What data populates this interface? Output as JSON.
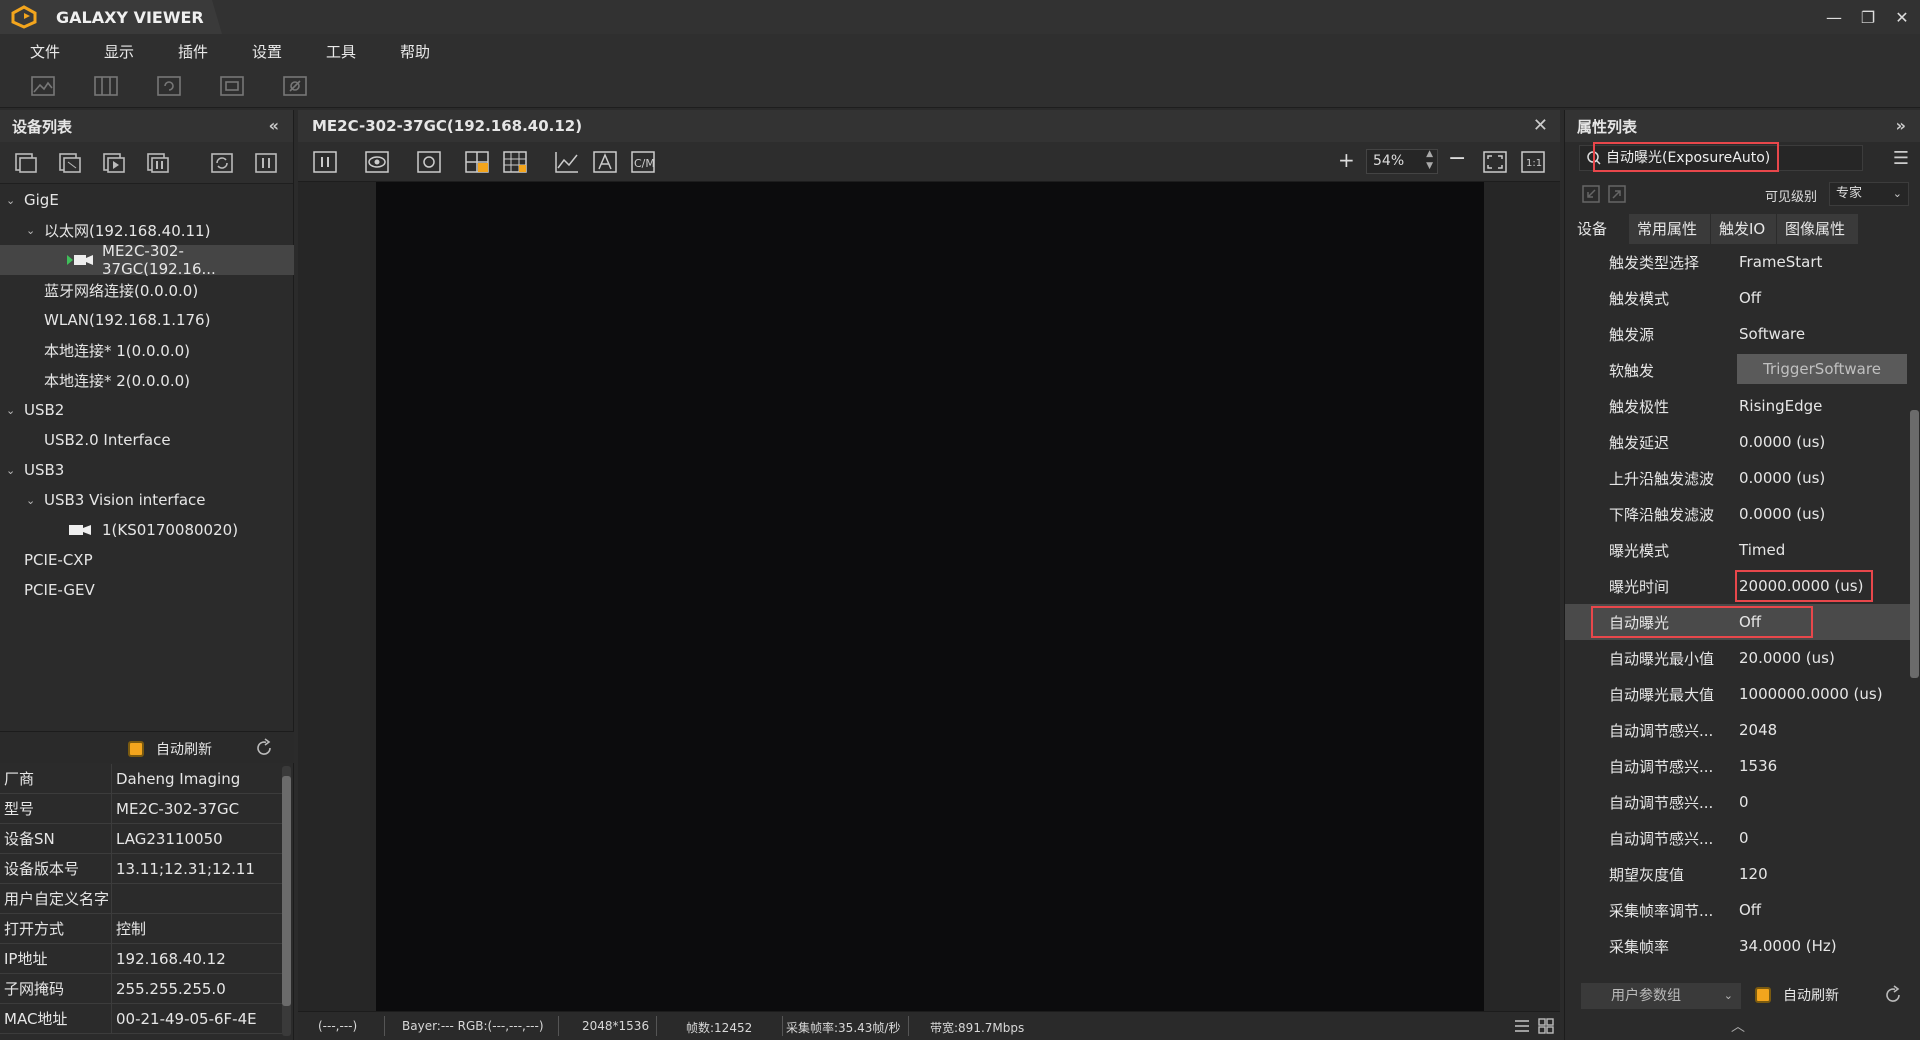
{
  "app": {
    "title": "GALAXY VIEWER"
  },
  "window_controls": {
    "minimize": "—",
    "restore": "❐",
    "close": "✕"
  },
  "menu": [
    "文件",
    "显示",
    "插件",
    "设置",
    "工具",
    "帮助"
  ],
  "left_panel": {
    "title": "设备列表",
    "collapse_glyph": "«",
    "tree": [
      {
        "label": "GigE",
        "level": 0,
        "expanded": true
      },
      {
        "label": "以太网(192.168.40.11)",
        "level": 1,
        "expanded": true
      },
      {
        "label": "ME2C-302-37GC(192.16...",
        "level": 2,
        "selected": true,
        "icon": "camera-connected-icon"
      },
      {
        "label": "蓝牙网络连接(0.0.0.0)",
        "level": 1
      },
      {
        "label": "WLAN(192.168.1.176)",
        "level": 1
      },
      {
        "label": "本地连接* 1(0.0.0.0)",
        "level": 1
      },
      {
        "label": "本地连接* 2(0.0.0.0)",
        "level": 1
      },
      {
        "label": "USB2",
        "level": 0,
        "expanded": true
      },
      {
        "label": "USB2.0 Interface",
        "level": 1
      },
      {
        "label": "USB3",
        "level": 0,
        "expanded": true
      },
      {
        "label": "USB3 Vision interface",
        "level": 1,
        "expanded": true
      },
      {
        "label": "1(KS0170080020)",
        "level": 2,
        "icon": "camera-icon"
      },
      {
        "label": "PCIE-CXP",
        "level": 0
      },
      {
        "label": "PCIE-GEV",
        "level": 0
      }
    ],
    "auto_refresh_label": "自动刷新",
    "device_info": [
      {
        "key": "厂商",
        "value": "Daheng Imaging"
      },
      {
        "key": "型号",
        "value": "ME2C-302-37GC"
      },
      {
        "key": "设备SN",
        "value": "LAG23110050"
      },
      {
        "key": "设备版本号",
        "value": "13.11;12.31;12.11"
      },
      {
        "key": "用户自定义名字",
        "value": ""
      },
      {
        "key": "打开方式",
        "value": "控制"
      },
      {
        "key": "IP地址",
        "value": "192.168.40.12"
      },
      {
        "key": "子网掩码",
        "value": "255.255.255.0"
      },
      {
        "key": "MAC地址",
        "value": "00-21-49-05-6F-4E"
      }
    ]
  },
  "viewer": {
    "title": "ME2C-302-37GC(192.168.40.12)",
    "close_glyph": "✕",
    "zoom": "54%",
    "zoom_plus": "+",
    "zoom_minus": "−",
    "status": {
      "cursor": "(---,---)",
      "pixel": "Bayer:---  RGB:(---,---,---)",
      "resolution": "2048*1536",
      "frames": "帧数:12452",
      "framerate": "采集帧率:35.43帧/秒",
      "bandwidth": "带宽:891.7Mbps"
    }
  },
  "right_panel": {
    "title": "属性列表",
    "expand_glyph": "»",
    "filter_value": "自动曝光(ExposureAuto)",
    "visibility_label": "可见级别",
    "visibility_value": "专家",
    "tabs": [
      "设备",
      "常用属性",
      "触发IO",
      "图像属性"
    ],
    "active_tab": 0,
    "properties": [
      {
        "key": "触发类型选择",
        "value": "FrameStart"
      },
      {
        "key": "触发模式",
        "value": "Off"
      },
      {
        "key": "触发源",
        "value": "Software"
      },
      {
        "key": "软触发",
        "value": "TriggerSoftware",
        "button": true
      },
      {
        "key": "触发极性",
        "value": "RisingEdge"
      },
      {
        "key": "触发延迟",
        "value": "0.0000 (us)"
      },
      {
        "key": "上升沿触发滤波",
        "value": "0.0000 (us)"
      },
      {
        "key": "下降沿触发滤波",
        "value": "0.0000 (us)"
      },
      {
        "key": "曝光模式",
        "value": "Timed"
      },
      {
        "key": "曝光时间",
        "value": "20000.0000 (us)",
        "highlight_value": true
      },
      {
        "key": "自动曝光",
        "value": "Off",
        "selected": true,
        "highlight_row": true
      },
      {
        "key": "自动曝光最小值",
        "value": "20.0000 (us)"
      },
      {
        "key": "自动曝光最大值",
        "value": "1000000.0000 (us)"
      },
      {
        "key": "自动调节感兴...",
        "value": "2048"
      },
      {
        "key": "自动调节感兴...",
        "value": "1536"
      },
      {
        "key": "自动调节感兴...",
        "value": "0"
      },
      {
        "key": "自动调节感兴...",
        "value": "0"
      },
      {
        "key": "期望灰度值",
        "value": "120"
      },
      {
        "key": "采集帧率调节...",
        "value": "Off"
      },
      {
        "key": "采集帧率",
        "value": "34.0000 (Hz)"
      }
    ],
    "param_group_label": "用户参数组",
    "auto_refresh_label": "自动刷新"
  },
  "colors": {
    "accent_orange": "#f3a51d",
    "highlight_red": "#e8474b",
    "background": "#2b2b2b"
  }
}
